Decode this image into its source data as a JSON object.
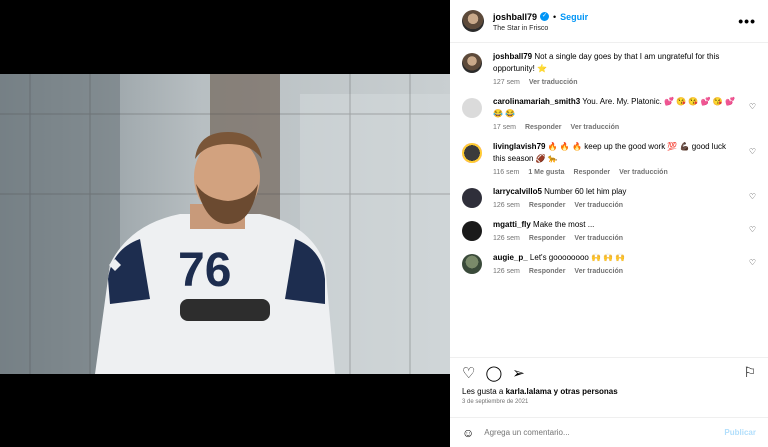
{
  "post": {
    "username": "joshball79",
    "follow_label": "Seguir",
    "location": "The Star in Frisco",
    "more_label": "•••",
    "caption": {
      "username": "joshball79",
      "text": "Not a single day goes by that I am ungrateful for this opportunity! ⭐",
      "time": "127 sem",
      "translate": "Ver traducción"
    },
    "comments": [
      {
        "username": "carolinamariah_smith3",
        "text": "You. Are. My. Platonic. 💕 😘 😘 💕 😘 💕 😂 😂",
        "time": "17 sem",
        "likes": "",
        "reply": "Responder",
        "translate": "Ver traducción"
      },
      {
        "username": "livinglavish79",
        "text": "🔥 🔥 🔥 keep up the good work 💯 💪🏿 good luck this season 🏈 🐆",
        "time": "116 sem",
        "likes": "1 Me gusta",
        "reply": "Responder",
        "translate": "Ver traducción"
      },
      {
        "username": "larrycalvillo5",
        "text": "Number 60 let him play",
        "time": "126 sem",
        "likes": "",
        "reply": "Responder",
        "translate": "Ver traducción"
      },
      {
        "username": "mgatti_fly",
        "text": "Make the most ...",
        "time": "126 sem",
        "likes": "",
        "reply": "Responder",
        "translate": "Ver traducción"
      },
      {
        "username": "augie_p_",
        "text": "Let's goooooooo 🙌 🙌 🙌",
        "time": "126 sem",
        "likes": "",
        "reply": "Responder",
        "translate": "Ver traducción"
      }
    ],
    "likes_prefix": "Les gusta a",
    "likes_user": "karla.lalama",
    "likes_suffix": "y otras personas",
    "date": "3 de septiembre de 2021",
    "add_comment_placeholder": "Agrega un comentario...",
    "publish_label": "Publicar"
  },
  "colors": {
    "accent": "#0095f6",
    "muted": "#737373"
  }
}
